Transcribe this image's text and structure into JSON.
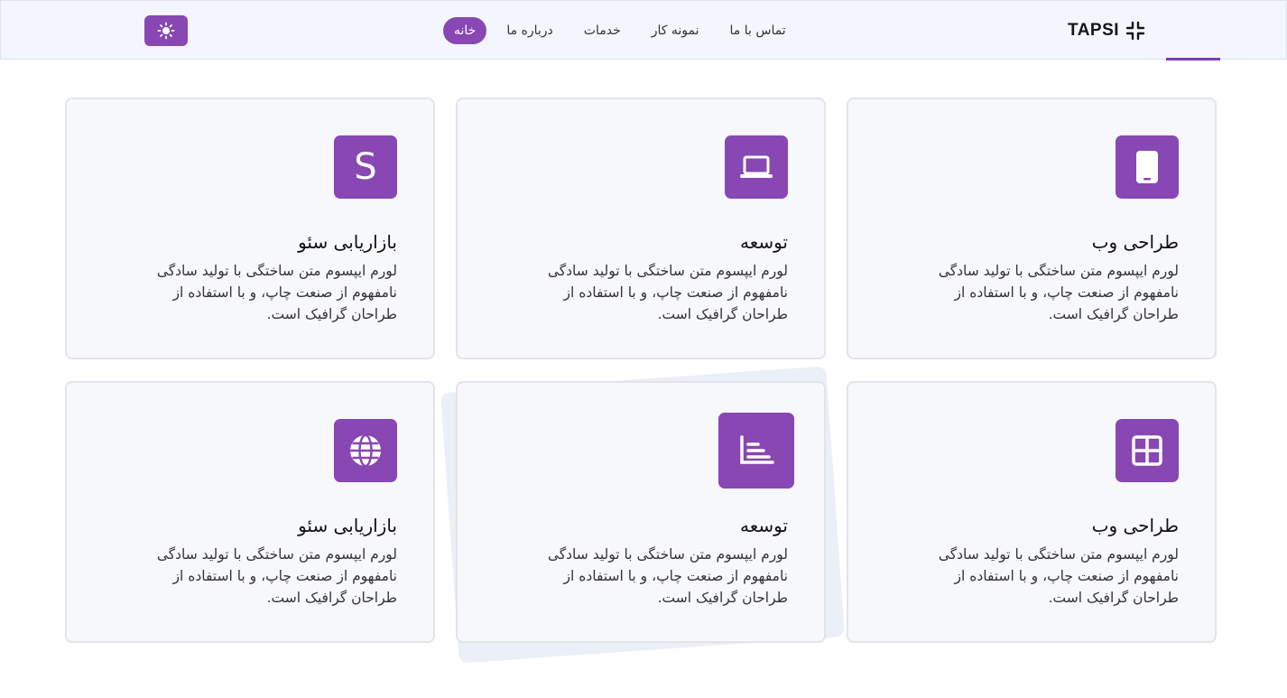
{
  "brand": {
    "name": "TAPSI"
  },
  "nav": {
    "items": [
      {
        "label": "خانه",
        "active": true
      },
      {
        "label": "درباره ما",
        "active": false
      },
      {
        "label": "خدمات",
        "active": false
      },
      {
        "label": "نمونه کار",
        "active": false
      },
      {
        "label": "تماس با ما",
        "active": false
      }
    ]
  },
  "theme_toggle": {
    "icon": "sun-icon"
  },
  "colors": {
    "accent": "#8847b3",
    "nav_bg": "#f3f6fd",
    "card_bg": "#f7f8fc"
  },
  "cards": [
    {
      "title": "طراحی وب",
      "description": "لورم ایپسوم متن ساختگی با تولید سادگی نامفهوم از صنعت چاپ، و با استفاده از طراحان گرافیک است.",
      "icon": "mobile-icon"
    },
    {
      "title": "توسعه",
      "description": "لورم ایپسوم متن ساختگی با تولید سادگی نامفهوم از صنعت چاپ، و با استفاده از طراحان گرافیک است.",
      "icon": "laptop-icon"
    },
    {
      "title": "بازاریابی سئو",
      "description": "لورم ایپسوم متن ساختگی با تولید سادگی نامفهوم از صنعت چاپ، و با استفاده از طراحان گرافیک است.",
      "icon": "s-letter-icon",
      "icon_text": "S"
    },
    {
      "title": "طراحی وب",
      "description": "لورم ایپسوم متن ساختگی با تولید سادگی نامفهوم از صنعت چاپ، و با استفاده از طراحان گرافیک است.",
      "icon": "grid-icon"
    },
    {
      "title": "توسعه",
      "description": "لورم ایپسوم متن ساختگی با تولید سادگی نامفهوم از صنعت چاپ، و با استفاده از طراحان گرافیک است.",
      "icon": "chart-icon"
    },
    {
      "title": "بازاریابی سئو",
      "description": "لورم ایپسوم متن ساختگی با تولید سادگی نامفهوم از صنعت چاپ، و با استفاده از طراحان گرافیک است.",
      "icon": "globe-icon"
    }
  ]
}
